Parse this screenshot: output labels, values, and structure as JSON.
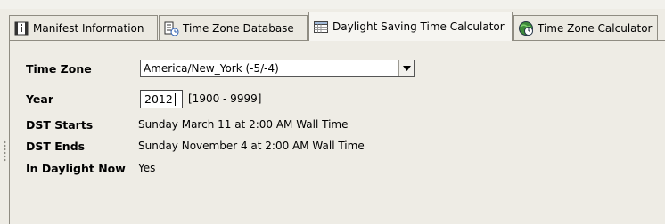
{
  "tabs": [
    {
      "label": "Manifest Information",
      "icon": "manifest-icon"
    },
    {
      "label": "Time Zone Database",
      "icon": "database-icon"
    },
    {
      "label": "Daylight Saving Time Calculator",
      "icon": "calendar-icon",
      "active": true
    },
    {
      "label": "Time Zone Calculator",
      "icon": "globe-clock-icon"
    }
  ],
  "form": {
    "timezone_label": "Time Zone",
    "timezone_value": "America/New_York (-5/-4)",
    "year_label": "Year",
    "year_value": "2012",
    "year_range": "[1900 - 9999]",
    "dst_starts_label": "DST Starts",
    "dst_starts_value": "Sunday March 11 at 2:00 AM Wall Time",
    "dst_ends_label": "DST Ends",
    "dst_ends_value": "Sunday November 4 at 2:00 AM Wall Time",
    "in_daylight_label": "In Daylight Now",
    "in_daylight_value": "Yes"
  },
  "colors": {
    "background": "#eeece5",
    "tab_border": "#8f8c82",
    "active_tab": "#f6f5f1"
  }
}
